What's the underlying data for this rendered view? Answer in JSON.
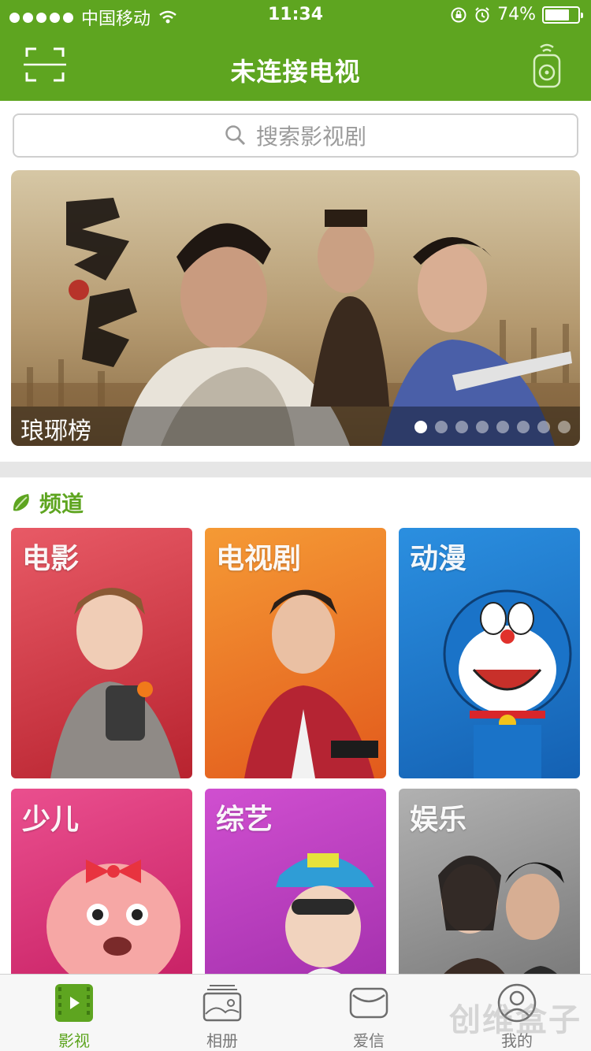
{
  "status_bar": {
    "carrier": "中国移动",
    "time": "11:34",
    "battery_percent": "74%",
    "battery_level": 0.74,
    "icons": [
      "signal-dots-icon",
      "wifi-icon",
      "rotation-lock-icon",
      "alarm-icon",
      "battery-icon"
    ]
  },
  "nav": {
    "title": "未连接电视",
    "left_icon": "scan-icon",
    "right_icon": "remote-control-icon"
  },
  "search": {
    "placeholder": "搜索影视剧",
    "icon": "search-icon"
  },
  "banner": {
    "caption": "琅琊榜",
    "page_count": 8,
    "active_page": 1
  },
  "section": {
    "title": "频道",
    "icon": "leaf-icon"
  },
  "channels": [
    {
      "label": "电影",
      "color": "#d23d47"
    },
    {
      "label": "电视剧",
      "color": "#ee6a22"
    },
    {
      "label": "动漫",
      "color": "#1b79c9"
    },
    {
      "label": "少儿",
      "color": "#d6246e"
    },
    {
      "label": "综艺",
      "color": "#b33bb2"
    },
    {
      "label": "娱乐",
      "color": "#8e8e8e"
    }
  ],
  "tabs": [
    {
      "label": "影视",
      "icon": "film-icon",
      "active": true
    },
    {
      "label": "相册",
      "icon": "album-icon",
      "active": false
    },
    {
      "label": "爱信",
      "icon": "message-icon",
      "active": false
    },
    {
      "label": "我的",
      "icon": "profile-icon",
      "active": false
    }
  ],
  "watermark": "创维盒子",
  "colors": {
    "brand_green": "#5ea520",
    "divider": "#e6e6e6"
  }
}
